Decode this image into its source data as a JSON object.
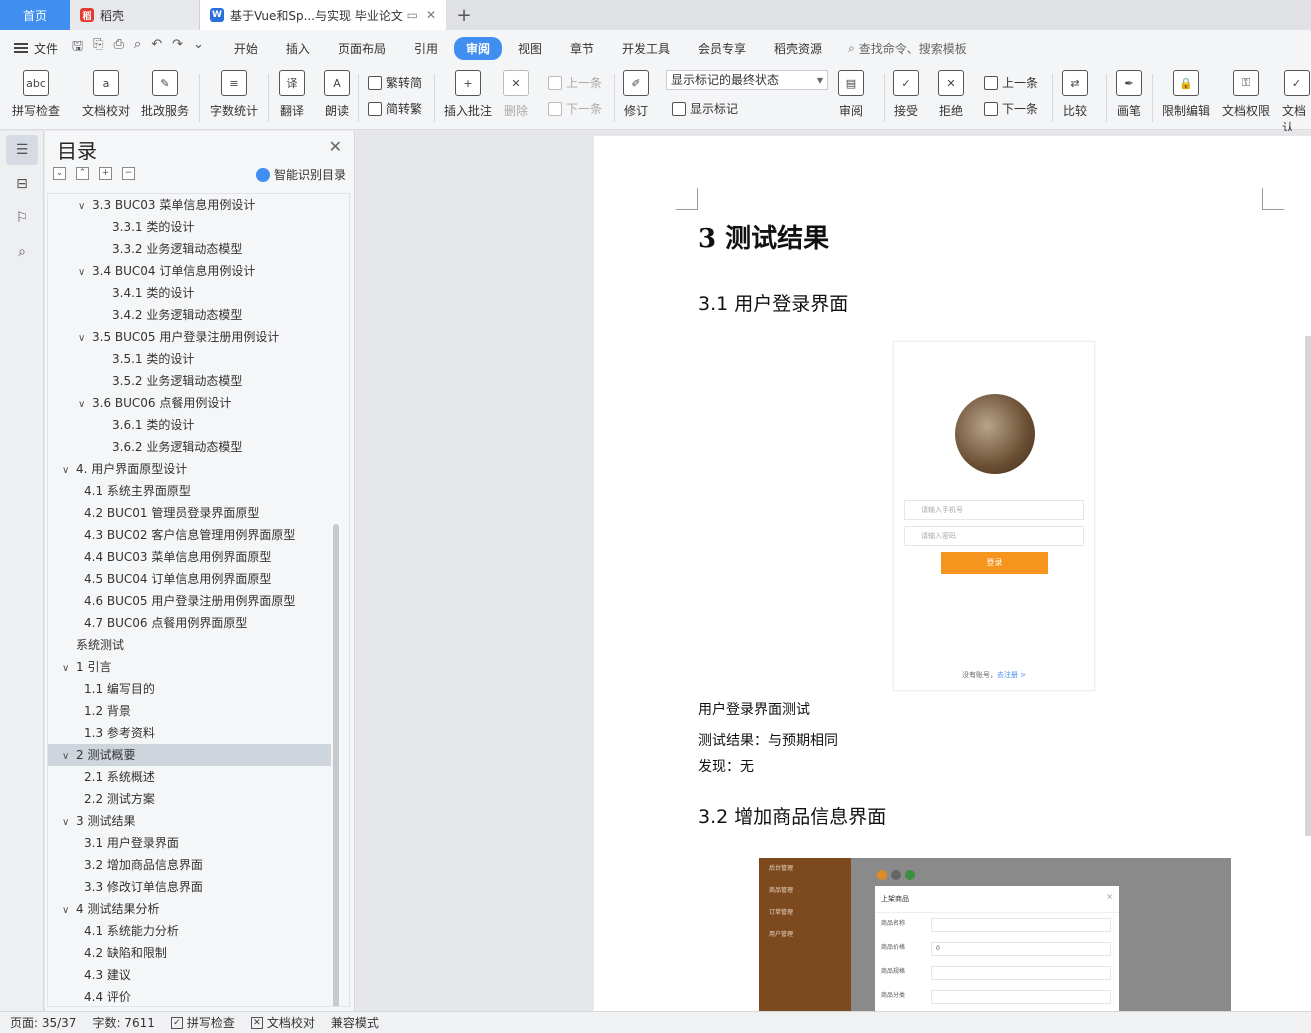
{
  "tabs": {
    "home": "首页",
    "daoke": "稻壳",
    "document": "基于Vue和Sp...与实现 毕业论文",
    "add_symbol": "+"
  },
  "menu": {
    "file": "文件",
    "items": [
      "开始",
      "插入",
      "页面布局",
      "引用",
      "审阅",
      "视图",
      "章节",
      "开发工具",
      "会员专享",
      "稻壳资源"
    ],
    "search": "查找命令、搜索模板"
  },
  "ribbon": {
    "spell_check": "拼写检查",
    "doc_proof": "文档校对",
    "batch_service": "批改服务",
    "word_count": "字数统计",
    "translate": "翻译",
    "read_aloud": "朗读",
    "trad_to_simp": "繁转简",
    "simp_to_trad": "简转繁",
    "insert_comment": "插入批注",
    "delete": "删除",
    "prev": "上一条",
    "next": "下一条",
    "track_changes": "修订",
    "markup_select": "显示标记的最终状态",
    "show_markup": "显示标记",
    "review": "审阅",
    "accept": "接受",
    "reject": "拒绝",
    "prev2": "上一条",
    "next2": "下一条",
    "compare": "比较",
    "pen": "画笔",
    "restrict_edit": "限制编辑",
    "doc_permission": "文档权限",
    "doc_cert": "文档认"
  },
  "toc": {
    "title": "目录",
    "smart": "智能识别目录",
    "items": [
      {
        "text": "3.3 BUC03  菜单信息用例设计",
        "level": 2,
        "chev": true
      },
      {
        "text": "3.3.1  类的设计",
        "level": 3,
        "chev": false
      },
      {
        "text": "3.3.2  业务逻辑动态模型",
        "level": 3,
        "chev": false
      },
      {
        "text": "3.4 BUC04  订单信息用例设计",
        "level": 2,
        "chev": true
      },
      {
        "text": "3.4.1  类的设计",
        "level": 3,
        "chev": false
      },
      {
        "text": "3.4.2  业务逻辑动态模型",
        "level": 3,
        "chev": false
      },
      {
        "text": "3.5 BUC05  用户登录注册用例设计",
        "level": 2,
        "chev": true
      },
      {
        "text": "3.5.1  类的设计",
        "level": 3,
        "chev": false
      },
      {
        "text": "3.5.2  业务逻辑动态模型",
        "level": 3,
        "chev": false
      },
      {
        "text": "3.6 BUC06  点餐用例设计",
        "level": 2,
        "chev": true
      },
      {
        "text": "3.6.1  类的设计",
        "level": 3,
        "chev": false
      },
      {
        "text": "3.6.2  业务逻辑动态模型",
        "level": 3,
        "chev": false
      },
      {
        "text": "4.  用户界面原型设计",
        "level": 1,
        "chev": true
      },
      {
        "text": "4.1  系统主界面原型",
        "level": 2,
        "chev": false
      },
      {
        "text": "4.2 BUC01 管理员登录界面原型",
        "level": 2,
        "chev": false
      },
      {
        "text": "4.3 BUC02  客户信息管理用例界面原型",
        "level": 2,
        "chev": false
      },
      {
        "text": "4.4 BUC03  菜单信息用例界面原型",
        "level": 2,
        "chev": false
      },
      {
        "text": "4.5 BUC04  订单信息用例界面原型",
        "level": 2,
        "chev": false
      },
      {
        "text": "4.6 BUC05  用户登录注册用例界面原型",
        "level": 2,
        "chev": false
      },
      {
        "text": "4.7 BUC06  点餐用例界面原型",
        "level": 2,
        "chev": false
      },
      {
        "text": "系统测试",
        "level": 1,
        "chev": false,
        "nochev": true
      },
      {
        "text": "1 引言",
        "level": 1,
        "chev": true
      },
      {
        "text": "1.1 编写目的",
        "level": 2,
        "chev": false
      },
      {
        "text": "1.2 背景",
        "level": 2,
        "chev": false
      },
      {
        "text": "1.3 参考资料",
        "level": 2,
        "chev": false
      },
      {
        "text": "2 测试概要",
        "level": 1,
        "chev": true,
        "selected": true
      },
      {
        "text": "2.1 系统概述",
        "level": 2,
        "chev": false
      },
      {
        "text": "2.2 测试方案",
        "level": 2,
        "chev": false
      },
      {
        "text": "3 测试结果",
        "level": 1,
        "chev": true
      },
      {
        "text": "3.1 用户登录界面",
        "level": 2,
        "chev": false
      },
      {
        "text": "3.2 增加商品信息界面",
        "level": 2,
        "chev": false
      },
      {
        "text": "3.3 修改订单信息界面",
        "level": 2,
        "chev": false
      },
      {
        "text": "4 测试结果分析",
        "level": 1,
        "chev": true
      },
      {
        "text": "4.1 系统能力分析",
        "level": 2,
        "chev": false
      },
      {
        "text": "4.2 缺陷和限制",
        "level": 2,
        "chev": false
      },
      {
        "text": "4.3 建议",
        "level": 2,
        "chev": false
      },
      {
        "text": "4.4 评价",
        "level": 2,
        "chev": false
      }
    ]
  },
  "document": {
    "h1": "3 测试结果",
    "h2_1": "3.1 用户登录界面",
    "login": {
      "phone_placeholder": "请输入手机号",
      "password_placeholder": "请输入密码",
      "button": "登录",
      "no_account": "没有账号，",
      "register": "去注册 >"
    },
    "caption": "用户登录界面测试",
    "result": "测试结果：与预期相同",
    "found": "发现：无",
    "h2_2": "3.2 增加商品信息界面",
    "product_modal": {
      "sidebar": [
        "后台管理",
        "商品管理",
        "订单管理",
        "用户管理"
      ],
      "title": "上架商品",
      "close": "×",
      "fields": [
        {
          "label": "商品名称",
          "value": ""
        },
        {
          "label": "商品价格",
          "value": "0"
        },
        {
          "label": "商品规格",
          "value": ""
        },
        {
          "label": "商品分类",
          "value": ""
        }
      ]
    }
  },
  "status": {
    "page": "页面: 35/37",
    "words": "字数: 7611",
    "spell": "拼写检查",
    "proof": "文档校对",
    "compat": "兼容模式"
  },
  "colors": {
    "accent": "#3f8ef0",
    "login_button": "#f7941d",
    "sidebar_brown": "#7d4a1f"
  }
}
